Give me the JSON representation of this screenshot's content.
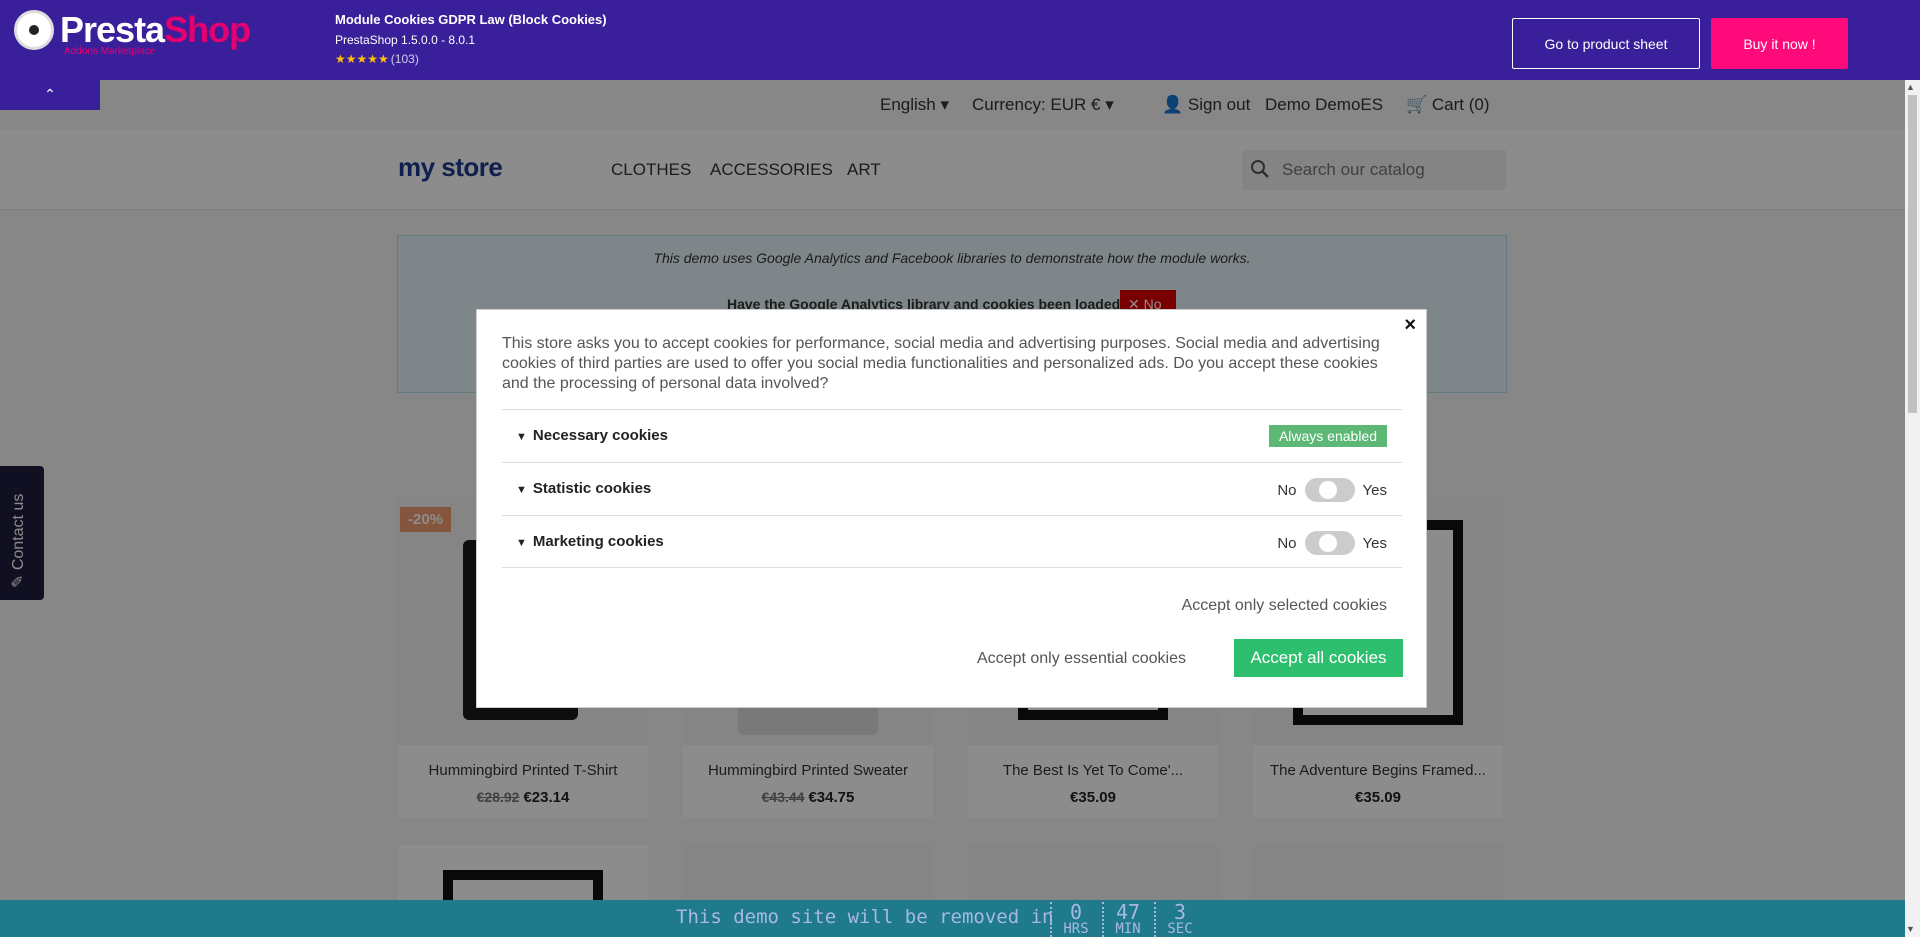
{
  "addons_bar": {
    "brand_presta": "Presta",
    "brand_shop": "Shop",
    "brand_sub": "Addons Marketplace",
    "module_title": "Module Cookies GDPR Law (Block Cookies)",
    "module_version": "PrestaShop 1.5.0.0 - 8.0.1",
    "rating_stars": "★★★★★",
    "rating_count": "(103)",
    "product_sheet_label": "Go to product sheet",
    "buy_label": "Buy it now !",
    "collapse_icon": "⌃"
  },
  "store_nav": {
    "language": "English",
    "currency": "Currency: EUR €",
    "sign_out": "Sign out",
    "user": "Demo DemoES",
    "cart": "Cart (0)"
  },
  "store_header": {
    "logo_text": "my store",
    "menu": [
      "CLOTHES",
      "ACCESSORIES",
      "ART"
    ],
    "search_placeholder": "Search our catalog"
  },
  "demo_box": {
    "text": "This demo uses Google Analytics and Facebook libraries to demonstrate how the module works.",
    "question": "Have the Google Analytics library and cookies been loaded?",
    "answer": "No"
  },
  "products": [
    {
      "name": "Hummingbird Printed T-Shirt",
      "old_price": "€28.92",
      "price": "€23.14",
      "discount": "-20%"
    },
    {
      "name": "Hummingbird Printed Sweater",
      "old_price": "€43.44",
      "price": "€34.75",
      "discount": ""
    },
    {
      "name": "The Best Is Yet To Come'...",
      "old_price": "",
      "price": "€35.09",
      "discount": ""
    },
    {
      "name": "The Adventure Begins Framed...",
      "old_price": "",
      "price": "€35.09",
      "discount": ""
    }
  ],
  "contact_tab": {
    "label": "Contact us"
  },
  "cookie_modal": {
    "text": "This store asks you to accept cookies for performance, social media and advertising purposes. Social media and advertising cookies of third parties are used to offer you social media functionalities and personalized ads. Do you accept these cookies and the processing of personal data involved?",
    "categories": [
      {
        "label": "Necessary cookies",
        "state": "Always enabled"
      },
      {
        "label": "Statistic cookies",
        "no": "No",
        "yes": "Yes"
      },
      {
        "label": "Marketing cookies",
        "no": "No",
        "yes": "Yes"
      }
    ],
    "accept_selected": "Accept only selected cookies",
    "accept_essential": "Accept only essential cookies",
    "accept_all": "Accept all cookies",
    "close_symbol": "×"
  },
  "banner": {
    "text": "This demo site will be removed in",
    "hours": "0",
    "hours_unit": "HRS",
    "minutes": "47",
    "minutes_unit": "MIN",
    "seconds": "3",
    "seconds_unit": "SEC"
  },
  "colors": {
    "addons_bar": "#3a1f9a",
    "buy_button": "#ff0a7a",
    "accept_all": "#2dbf6d",
    "always_enabled": "#5cb874"
  }
}
